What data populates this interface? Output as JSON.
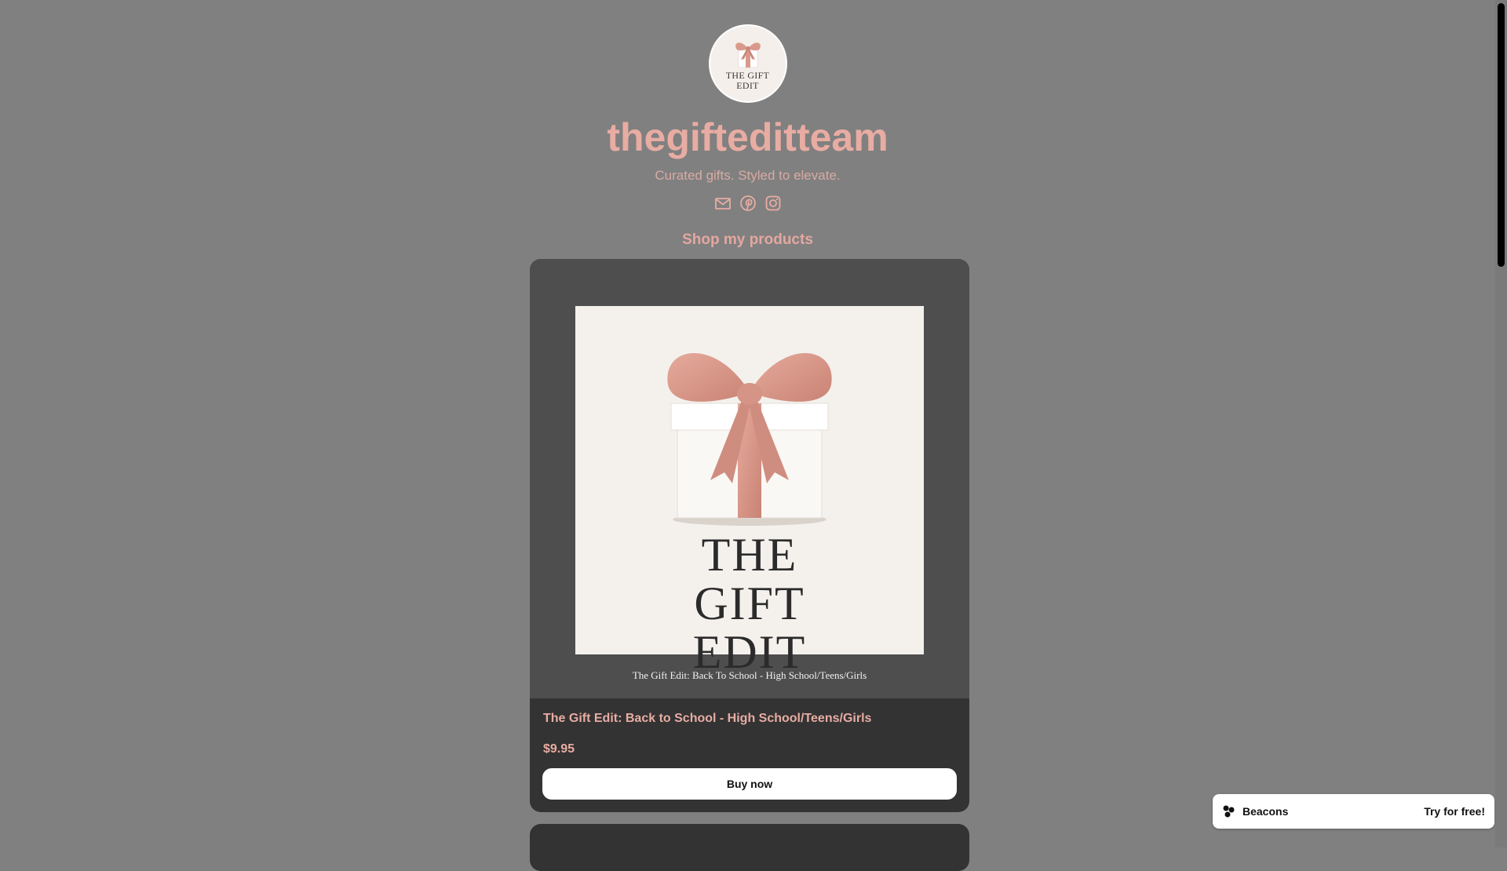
{
  "profile": {
    "avatar_text": "THE GIFT EDIT",
    "username": "thegifteditteam",
    "bio": "Curated gifts. Styled to elevate.",
    "socials": [
      "mail-icon",
      "pinterest-icon",
      "instagram-icon"
    ]
  },
  "section": {
    "title": "Shop my products"
  },
  "products": [
    {
      "image_title": "THE GIFT EDIT",
      "image_caption": "The Gift Edit: Back To School - High School/Teens/Girls",
      "name": "The Gift Edit: Back to School - High School/Teens/Girls",
      "price": "$9.95",
      "button_label": "Buy now"
    }
  ],
  "footer_badge": {
    "brand": "Beacons",
    "cta": "Try for free!"
  },
  "colors": {
    "background": "#808080",
    "accent": "#e8aca3",
    "card": "#333333",
    "ribbon": "#d99a8c"
  }
}
